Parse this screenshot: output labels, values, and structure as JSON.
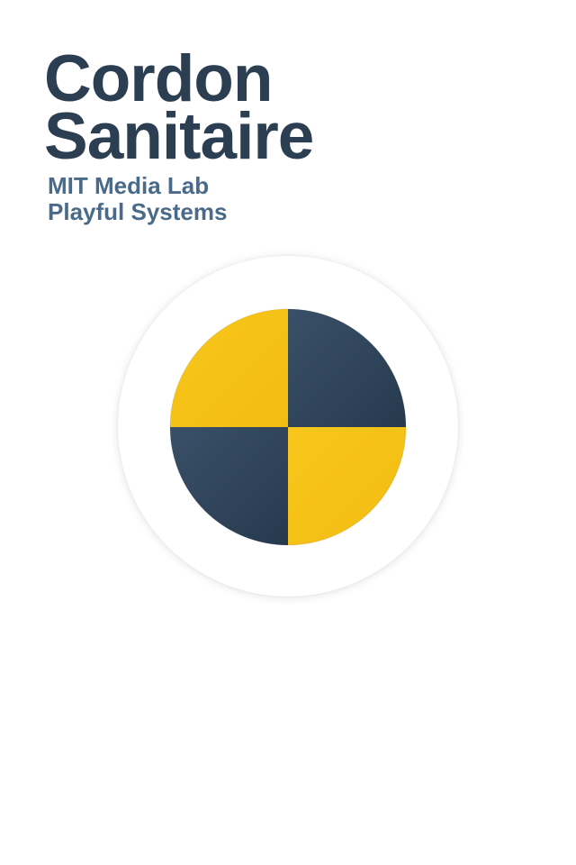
{
  "app": {
    "title_line1": "Cordon",
    "title_line2": "Sanitaire",
    "subtitle_line1": "MIT Media Lab",
    "subtitle_line2": "Playful Systems"
  },
  "colors": {
    "title": "#2b3e52",
    "subtitle": "#4a6a8a",
    "logo_dark": "#2e4359",
    "logo_yellow": "#f5c518",
    "background": "#ffffff"
  },
  "logo": {
    "icon": "quartered-circle-logo-icon"
  }
}
